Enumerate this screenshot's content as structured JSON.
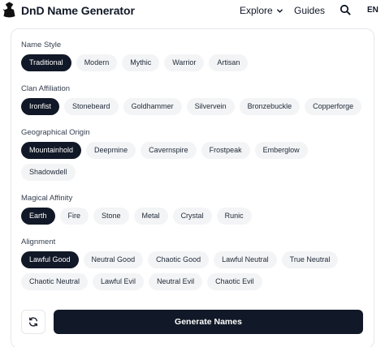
{
  "header": {
    "title": "DnD Name Generator",
    "nav": {
      "explore": "Explore",
      "guides": "Guides",
      "lang": "EN"
    }
  },
  "sections": [
    {
      "label": "Name Style",
      "selected": "Traditional",
      "options": [
        "Traditional",
        "Modern",
        "Mythic",
        "Warrior",
        "Artisan"
      ]
    },
    {
      "label": "Clan Affiliation",
      "selected": "Ironfist",
      "options": [
        "Ironfist",
        "Stonebeard",
        "Goldhammer",
        "Silvervein",
        "Bronzebuckle",
        "Copperforge"
      ]
    },
    {
      "label": "Geographical Origin",
      "selected": "Mountainhold",
      "options": [
        "Mountainhold",
        "Deepmine",
        "Cavernspire",
        "Frostpeak",
        "Emberglow",
        "Shadowdell"
      ]
    },
    {
      "label": "Magical Affinity",
      "selected": "Earth",
      "options": [
        "Earth",
        "Fire",
        "Stone",
        "Metal",
        "Crystal",
        "Runic"
      ]
    },
    {
      "label": "Alignment",
      "selected": "Lawful Good",
      "options": [
        "Lawful Good",
        "Neutral Good",
        "Chaotic Good",
        "Lawful Neutral",
        "True Neutral",
        "Chaotic Neutral",
        "Lawful Evil",
        "Neutral Evil",
        "Chaotic Evil"
      ]
    }
  ],
  "actions": {
    "generate": "Generate Names"
  },
  "colors": {
    "primary": "#111827",
    "chip_bg": "#f3f4f6",
    "border": "#e5e7eb"
  }
}
